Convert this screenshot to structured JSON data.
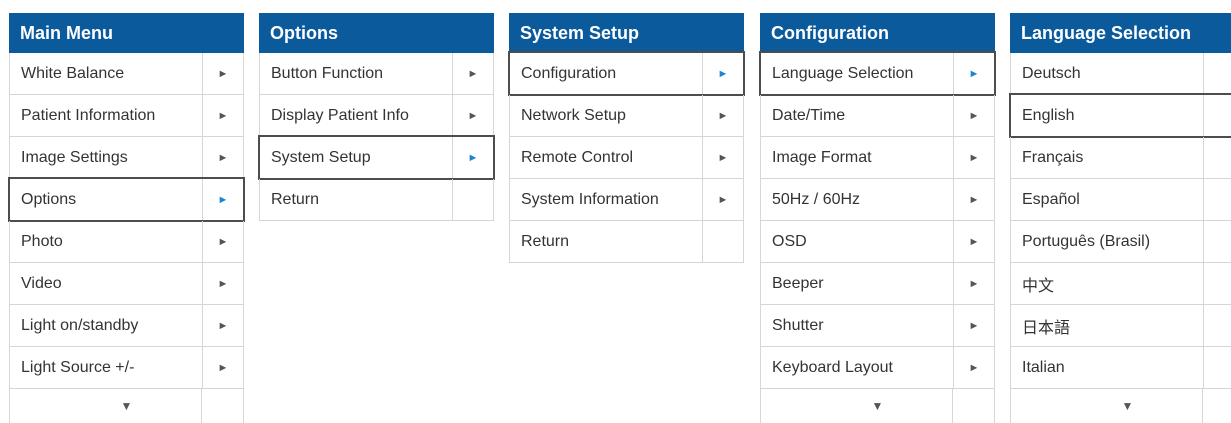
{
  "menus": [
    {
      "id": "main-menu",
      "title": "Main Menu",
      "items": [
        {
          "label": "White Balance",
          "arrow": "►"
        },
        {
          "label": "Patient Information",
          "arrow": "►"
        },
        {
          "label": "Image Settings",
          "arrow": "►"
        },
        {
          "label": "Options",
          "arrow": "►",
          "selected": true
        },
        {
          "label": "Photo",
          "arrow": "►"
        },
        {
          "label": "Video",
          "arrow": "►"
        },
        {
          "label": "Light on/standby",
          "arrow": "►"
        },
        {
          "label": "Light Source +/-",
          "arrow": "►"
        }
      ],
      "more": "▼"
    },
    {
      "id": "options",
      "title": "Options",
      "items": [
        {
          "label": "Button Function",
          "arrow": "►"
        },
        {
          "label": "Display Patient Info",
          "arrow": "►"
        },
        {
          "label": "System Setup",
          "arrow": "►",
          "selected": true
        },
        {
          "label": "Return",
          "arrow": ""
        }
      ]
    },
    {
      "id": "system-setup",
      "title": "System Setup",
      "items": [
        {
          "label": "Configuration",
          "arrow": "►",
          "selected": true
        },
        {
          "label": "Network Setup",
          "arrow": "►"
        },
        {
          "label": "Remote Control",
          "arrow": "►"
        },
        {
          "label": "System Information",
          "arrow": "►"
        },
        {
          "label": "Return",
          "arrow": ""
        }
      ]
    },
    {
      "id": "configuration",
      "title": "Configuration",
      "items": [
        {
          "label": "Language Selection",
          "arrow": "►",
          "selected": true
        },
        {
          "label": "Date/Time",
          "arrow": "►"
        },
        {
          "label": "Image Format",
          "arrow": "►"
        },
        {
          "label": "50Hz / 60Hz",
          "arrow": "►"
        },
        {
          "label": "OSD",
          "arrow": "►"
        },
        {
          "label": "Beeper",
          "arrow": "►"
        },
        {
          "label": "Shutter",
          "arrow": "►"
        },
        {
          "label": "Keyboard Layout",
          "arrow": "►"
        }
      ],
      "more": "▼"
    },
    {
      "id": "language-selection",
      "title": "Language Selection",
      "items": [
        {
          "label": "Deutsch",
          "arrow": ""
        },
        {
          "label": "English",
          "arrow": "",
          "selected": true
        },
        {
          "label": "Français",
          "arrow": ""
        },
        {
          "label": "Español",
          "arrow": ""
        },
        {
          "label": "Português (Brasil)",
          "arrow": ""
        },
        {
          "label": "中文",
          "arrow": ""
        },
        {
          "label": "日本語",
          "arrow": ""
        },
        {
          "label": "Italian",
          "arrow": ""
        }
      ],
      "more": "▼"
    }
  ],
  "colors": {
    "header_bg": "#0a5a9c",
    "selected_arrow": "#1a86d0",
    "selection_border": "#4d4d4d"
  }
}
